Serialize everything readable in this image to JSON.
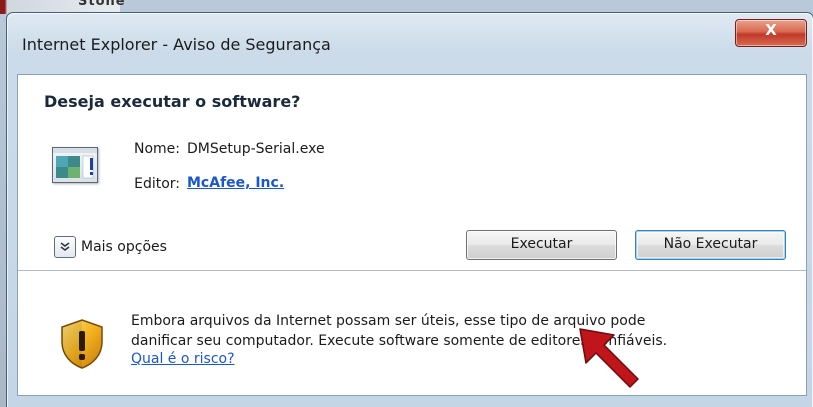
{
  "background": {
    "corner_text": "Stone"
  },
  "window": {
    "title": "Internet Explorer - Aviso de Segurança",
    "close_glyph": "X"
  },
  "dialog": {
    "heading": "Deseja executar o software?",
    "icon": "application-icon",
    "name_label": "Nome:",
    "name_value": "DMSetup-Serial.exe",
    "publisher_label": "Editor:",
    "publisher_value": "McAfee, Inc.",
    "more_options_label": "Mais opções",
    "more_options_icon": "chevron-down-icon",
    "run_button": "Executar",
    "dont_run_button": "Não Executar"
  },
  "warning": {
    "icon": "security-shield-icon",
    "line1": "Embora arquivos da Internet possam ser úteis, esse tipo de arquivo pode",
    "line2": "danificar seu computador. Execute software somente de editores confiáveis.",
    "risk_link": "Qual é o risco?"
  },
  "annotation": {
    "icon": "pointer-arrow-icon",
    "color": "#c0151a"
  },
  "colors": {
    "link": "#1a58c8",
    "close_button": "#c0392b"
  }
}
